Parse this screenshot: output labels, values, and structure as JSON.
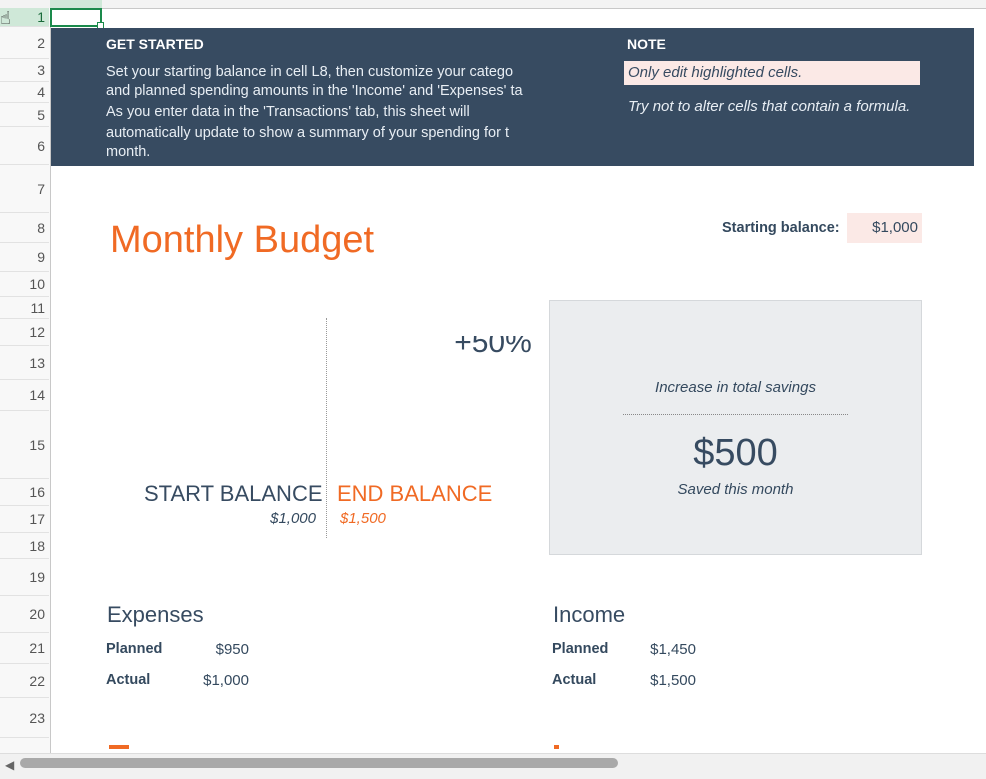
{
  "rows": [
    "1",
    "2",
    "3",
    "4",
    "5",
    "6",
    "7",
    "8",
    "9",
    "10",
    "11",
    "12",
    "13",
    "14",
    "15",
    "16",
    "17",
    "18",
    "19",
    "20",
    "21",
    "22",
    "23"
  ],
  "banner": {
    "get_started_title": "GET STARTED",
    "get_started_lines": [
      "Set your starting balance in cell L8, then customize your catego",
      "and planned spending amounts in the 'Income' and 'Expenses' ta",
      "As you enter data in the 'Transactions' tab, this sheet will",
      "automatically update to show a summary of your spending for t",
      "month."
    ],
    "note_title": "NOTE",
    "note_highlight": "Only edit highlighted cells.",
    "note_text": "Try not to alter cells that contain a formula."
  },
  "title": "Monthly Budget",
  "starting_balance": {
    "label": "Starting balance:",
    "value": "$1,000"
  },
  "balances": {
    "start_label": "START BALANCE",
    "start_value": "$1,000",
    "end_label": "END BALANCE",
    "end_value": "$1,500"
  },
  "savings": {
    "percent": "+50%",
    "percent_caption": "Increase in total savings",
    "amount": "$500",
    "amount_caption": "Saved this month"
  },
  "expenses": {
    "title": "Expenses",
    "planned_label": "Planned",
    "planned": "$950",
    "actual_label": "Actual",
    "actual": "$1,000"
  },
  "income": {
    "title": "Income",
    "planned_label": "Planned",
    "planned": "$1,450",
    "actual_label": "Actual",
    "actual": "$1,500"
  },
  "colors": {
    "banner": "#374b61",
    "accent": "#f06a24",
    "highlight": "#fbe9e6",
    "card": "#ebedef"
  }
}
